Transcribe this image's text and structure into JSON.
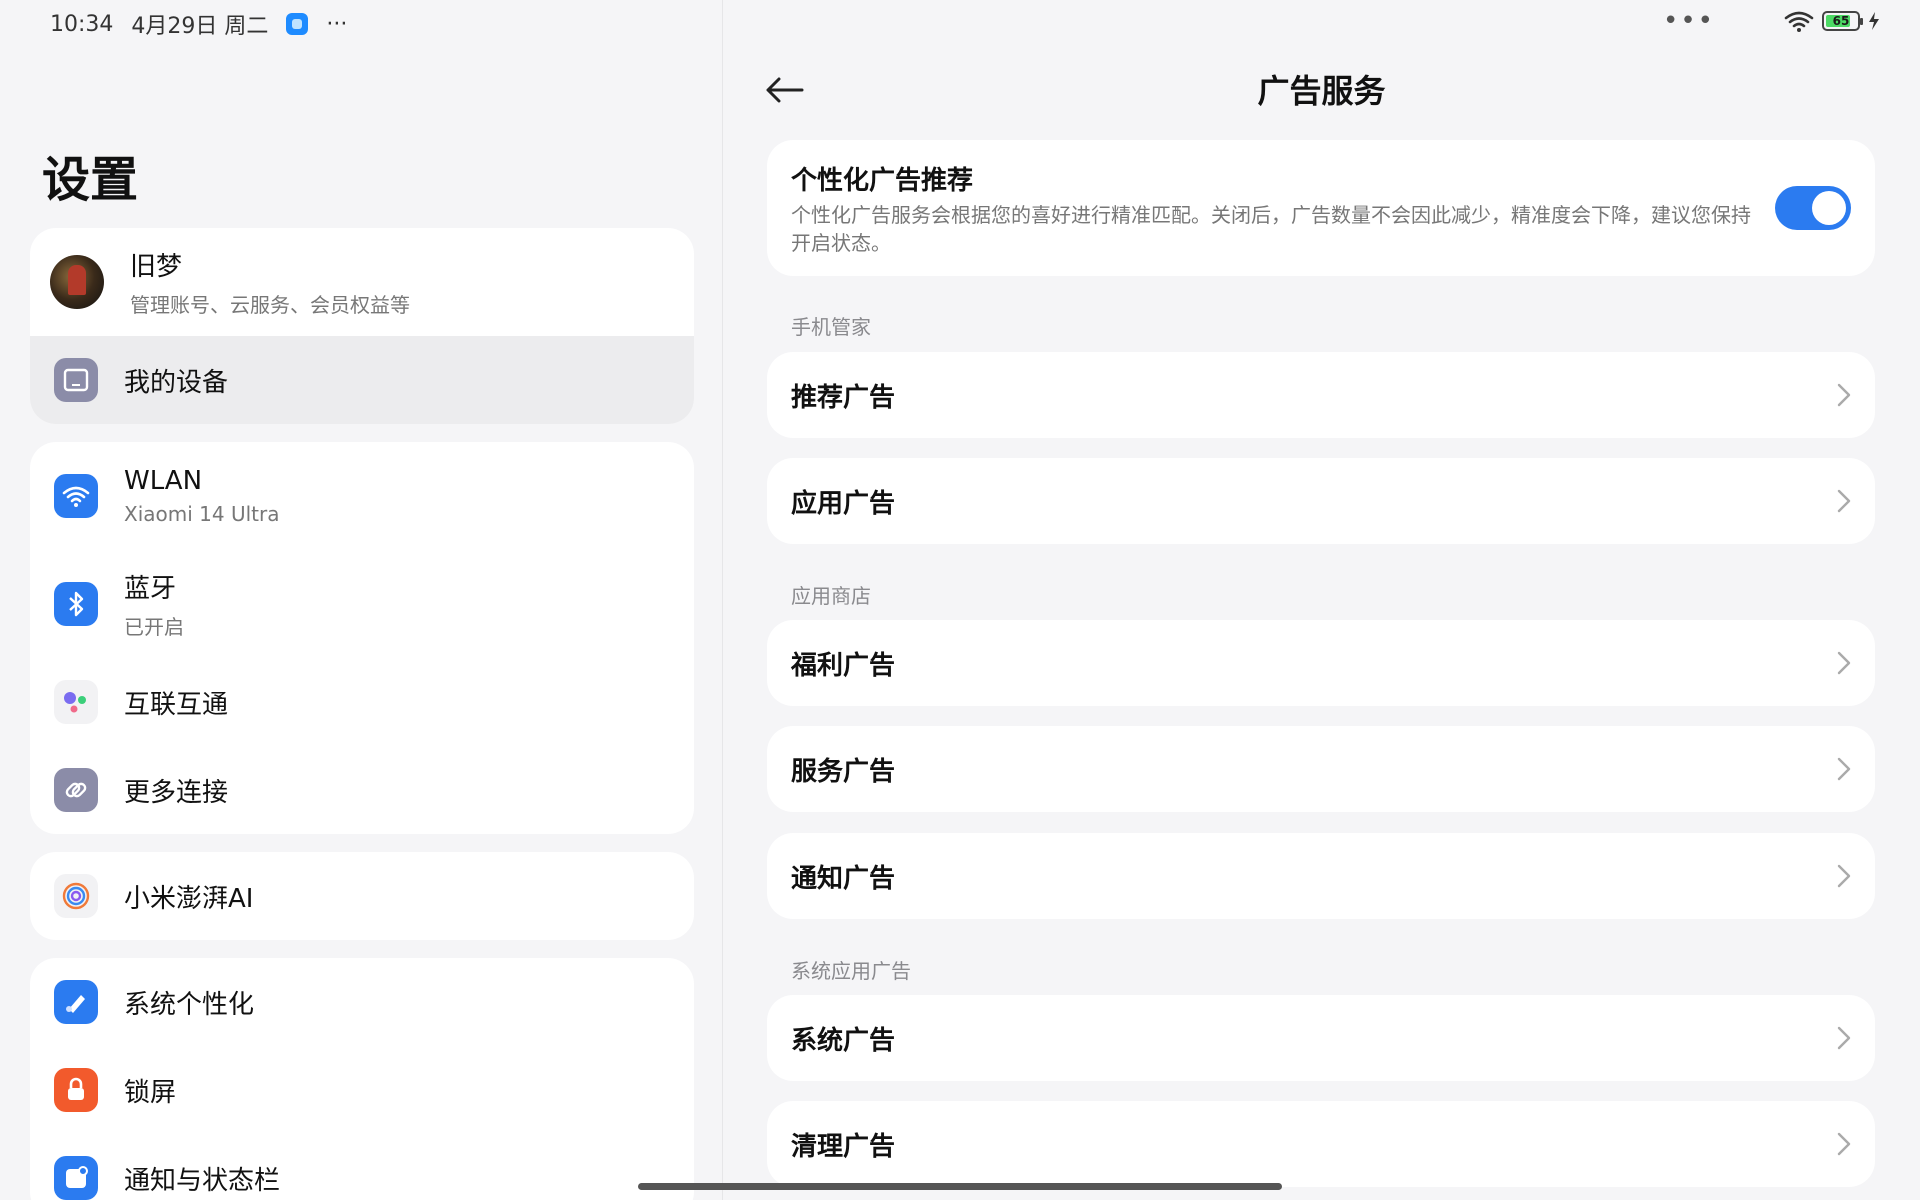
{
  "status_bar": {
    "time": "10:34",
    "date": "4月29日 周二",
    "overflow": "···",
    "center_dots": "•••",
    "battery": "65"
  },
  "settings": {
    "title": "设置",
    "account": {
      "name": "旧梦",
      "subtitle": "管理账号、云服务、会员权益等"
    },
    "my_device": "我的设备",
    "wlan": {
      "label": "WLAN",
      "subtitle": "Xiaomi 14 Ultra"
    },
    "bluetooth": {
      "label": "蓝牙",
      "subtitle": "已开启"
    },
    "interconnect": "互联互通",
    "more_connections": "更多连接",
    "xiaomi_ai": "小米澎湃AI",
    "personalization": "系统个性化",
    "lock_screen": "锁屏",
    "notifications": "通知与状态栏"
  },
  "ad_services": {
    "title": "广告服务",
    "personalized": {
      "title": "个性化广告推荐",
      "description": "个性化广告服务会根据您的喜好进行精准匹配。关闭后，广告数量不会因此减少，精准度会下降，建议您保持开启状态。",
      "enabled": true
    },
    "sections": {
      "phone_manager": "手机管家",
      "app_store": "应用商店",
      "system_apps": "系统应用广告"
    },
    "items": {
      "recommended": "推荐广告",
      "app": "应用广告",
      "welfare": "福利广告",
      "service": "服务广告",
      "notification": "通知广告",
      "system": "系统广告",
      "cleanup": "清理广告"
    }
  },
  "colors": {
    "accent": "#2b7bf0",
    "background": "#f5f5f7",
    "card": "#ffffff"
  }
}
